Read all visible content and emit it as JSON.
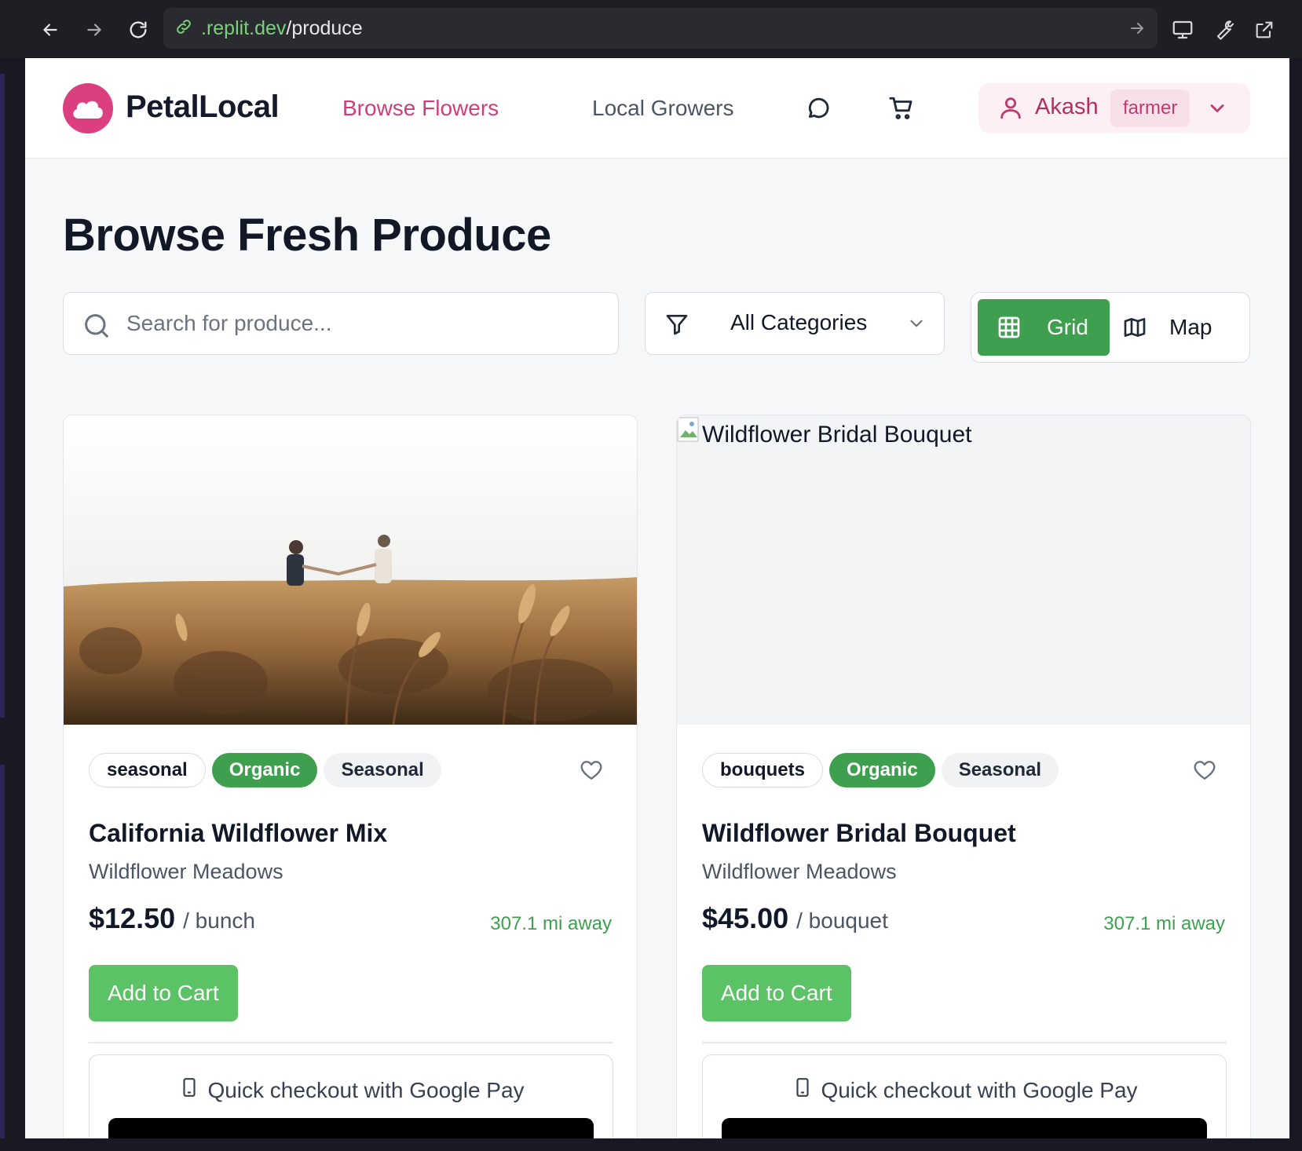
{
  "browser": {
    "url_host": ".replit.dev",
    "url_path": "/produce"
  },
  "header": {
    "brand": "PetalLocal",
    "nav": [
      {
        "label": "Browse Flowers",
        "active": true
      },
      {
        "label": "Local Growers",
        "active": false
      }
    ],
    "user": {
      "name": "Akash",
      "role": "farmer"
    }
  },
  "page": {
    "title": "Browse Fresh Produce"
  },
  "filters": {
    "search_placeholder": "Search for produce...",
    "category_selected": "All Categories",
    "view_grid_label": "Grid",
    "view_map_label": "Map",
    "active_view": "grid"
  },
  "products": [
    {
      "image_alt": "",
      "tags": [
        "seasonal",
        "Organic",
        "Seasonal"
      ],
      "title": "California Wildflower Mix",
      "farm": "Wildflower Meadows",
      "price": "$12.50",
      "unit": "/ bunch",
      "distance": "307.1 mi away",
      "add_label": "Add to Cart",
      "gpay_label": "Quick checkout with Google Pay"
    },
    {
      "image_alt": "Wildflower Bridal Bouquet",
      "tags": [
        "bouquets",
        "Organic",
        "Seasonal"
      ],
      "title": "Wildflower Bridal Bouquet",
      "farm": "Wildflower Meadows",
      "price": "$45.00",
      "unit": "/ bouquet",
      "distance": "307.1 mi away",
      "add_label": "Add to Cart",
      "gpay_label": "Quick checkout with Google Pay"
    }
  ],
  "colors": {
    "brand_pink": "#db3f7f",
    "accent_green": "#3ea04f",
    "button_green": "#5cc266"
  }
}
